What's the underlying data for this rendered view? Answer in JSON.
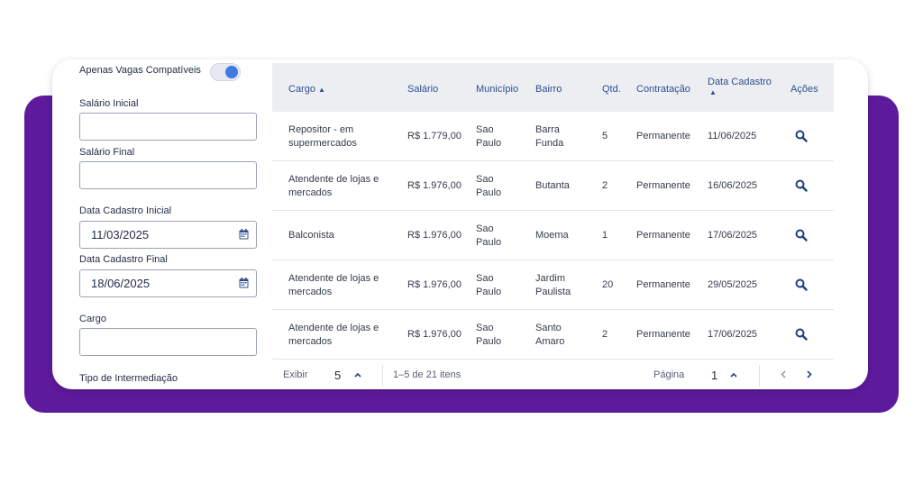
{
  "filters": {
    "toggle_label": "Apenas Vagas Compatíveis",
    "toggle_on": true,
    "salario_inicial_label": "Salário Inicial",
    "salario_inicial_value": "",
    "salario_final_label": "Salário Final",
    "salario_final_value": "",
    "data_inicial_label": "Data Cadastro Inicial",
    "data_inicial_value": "11/03/2025",
    "data_final_label": "Data Cadastro Final",
    "data_final_value": "18/06/2025",
    "cargo_label": "Cargo",
    "cargo_value": "",
    "intermediacao_label": "Tipo de Intermediação"
  },
  "table": {
    "headers": {
      "cargo": "Cargo",
      "salario": "Salário",
      "municipio": "Município",
      "bairro": "Bairro",
      "qtd": "Qtd.",
      "contratacao": "Contratação",
      "data_cadastro": "Data Cadastro",
      "acoes": "Ações"
    },
    "rows": [
      {
        "cargo_1": "Repositor - em",
        "cargo_2": "supermercados",
        "salario": "R$ 1.779,00",
        "municipio_1": "Sao",
        "municipio_2": "Paulo",
        "bairro_1": "Barra",
        "bairro_2": "Funda",
        "qtd": "5",
        "contratacao": "Permanente",
        "data": "11/06/2025"
      },
      {
        "cargo_1": "Atendente de lojas e",
        "cargo_2": "mercados",
        "salario": "R$ 1.976,00",
        "municipio_1": "Sao",
        "municipio_2": "Paulo",
        "bairro_1": "Butanta",
        "bairro_2": "",
        "qtd": "2",
        "contratacao": "Permanente",
        "data": "16/06/2025"
      },
      {
        "cargo_1": "Balconista",
        "cargo_2": "",
        "salario": "R$ 1.976,00",
        "municipio_1": "Sao",
        "municipio_2": "Paulo",
        "bairro_1": "Moema",
        "bairro_2": "",
        "qtd": "1",
        "contratacao": "Permanente",
        "data": "17/06/2025"
      },
      {
        "cargo_1": "Atendente de lojas e",
        "cargo_2": "mercados",
        "salario": "R$ 1.976,00",
        "municipio_1": "Sao",
        "municipio_2": "Paulo",
        "bairro_1": "Jardim",
        "bairro_2": "Paulista",
        "qtd": "20",
        "contratacao": "Permanente",
        "data": "29/05/2025"
      },
      {
        "cargo_1": "Atendente de lojas e",
        "cargo_2": "mercados",
        "salario": "R$ 1.976,00",
        "municipio_1": "Sao",
        "municipio_2": "Paulo",
        "bairro_1": "Santo",
        "bairro_2": "Amaro",
        "qtd": "2",
        "contratacao": "Permanente",
        "data": "17/06/2025"
      }
    ]
  },
  "pagination": {
    "exibir_label": "Exibir",
    "exibir_value": "5",
    "range_text": "1–5 de 21 itens",
    "pagina_label": "Página",
    "pagina_value": "1"
  },
  "colors": {
    "brand_purple": "#5e1a9c",
    "header_text": "#2c4f93",
    "toggle_on": "#3f7be0"
  },
  "icons": {
    "row_action": "search-icon",
    "date_picker": "calendar-icon",
    "sort": "sort-arrows-icon"
  }
}
